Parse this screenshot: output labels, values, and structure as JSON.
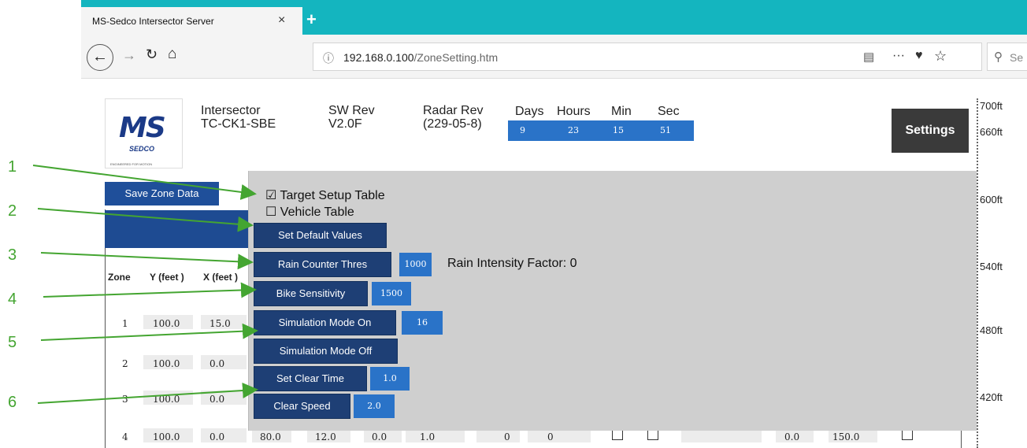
{
  "browser": {
    "tab_title": "MS-Sedco Intersector Server",
    "tab_close": "×",
    "new_tab": "+",
    "url_host": "192.168.0.100",
    "url_path": "/ZoneSetting.htm",
    "search_placeholder": "Se"
  },
  "header": {
    "logo_text": "MS",
    "logo_sub": "SEDCO",
    "logo_tagline": "ENGINEERED FOR MOTION",
    "device_label": "Intersector",
    "device_model": "TC-CK1-SBE",
    "sw_rev_label": "SW Rev",
    "sw_rev_value": "V2.0F",
    "radar_rev_label": "Radar Rev",
    "radar_rev_value": "(229-05-8)",
    "uptime_labels": [
      "Days",
      "Hours",
      "Min",
      "Sec"
    ],
    "uptime_values": [
      "9",
      "23",
      "15",
      "51"
    ],
    "settings_label": "Settings"
  },
  "ruler": {
    "labels": [
      "700ft",
      "660ft",
      "600ft",
      "540ft",
      "480ft",
      "420ft"
    ]
  },
  "zone_table": {
    "save_label": "Save Zone Data",
    "headers": [
      "Zone",
      "Y (feet )",
      "X (feet )"
    ],
    "rows": [
      {
        "zone": "1",
        "y": "100.0",
        "x": "15.0"
      },
      {
        "zone": "2",
        "y": "100.0",
        "x": "0.0"
      },
      {
        "zone": "3",
        "y": "100.0",
        "x": "0.0"
      },
      {
        "zone": "4",
        "y": "100.0",
        "x": "0.0",
        "c3": "80.0",
        "c4": "12.0",
        "c5": "0.0",
        "c6": "1.0",
        "c7": "0",
        "c8": "0",
        "c9": "0.0",
        "c10": "150.0"
      }
    ]
  },
  "panel": {
    "target_setup_label": "Target Setup Table",
    "target_setup_checked": "☑",
    "vehicle_table_label": "Vehicle Table",
    "vehicle_table_checked": "☐",
    "set_default_label": "Set Default Values",
    "rain_counter_label": "Rain Counter Thres",
    "rain_counter_value": "1000",
    "rain_factor_text": "Rain Intensity Factor: 0",
    "bike_label": "Bike Sensitivity",
    "bike_value": "1500",
    "sim_on_label": "Simulation Mode On",
    "sim_on_value": "16",
    "sim_off_label": "Simulation Mode Off",
    "clear_time_label": "Set Clear Time",
    "clear_time_value": "1.0",
    "clear_speed_label": "Clear Speed",
    "clear_speed_value": "2.0"
  },
  "annotations": [
    "1",
    "2",
    "3",
    "4",
    "5",
    "6"
  ],
  "colors": {
    "tabbar": "#14b5bf",
    "button_dark": "#1e3f75",
    "value_blue": "#2a73c8",
    "annotation_green": "#44a531"
  }
}
